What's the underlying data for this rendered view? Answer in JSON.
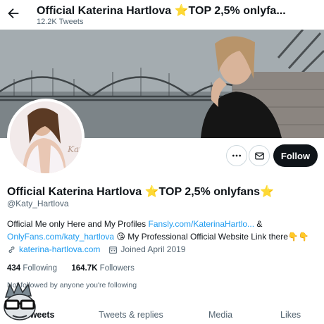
{
  "header": {
    "title": "Official Katerina Hartlova ⭐TOP 2,5% onlyfa...",
    "tweets_count": "12.2K Tweets"
  },
  "profile": {
    "name": "Official Katerina Hartlova ⭐TOP 2,5% onlyfans⭐",
    "handle": "@Katy_Hartlova",
    "bio": {
      "part1": "Official Me only Here and My Profiles ",
      "link1": "Fansly.com/KaterinaHartlo...",
      "part2": " & ",
      "link2": "OnlyFans.com/katy_hartlova",
      "part3": " 😘 My Professional Official Website Link there👇👇"
    },
    "website": "katerina-hartlova.com",
    "joined": "Joined April 2019",
    "following_count": "434",
    "following_label": "Following",
    "followers_count": "164.7K",
    "followers_label": "Followers",
    "followed_by": "Not followed by anyone you're following"
  },
  "actions": {
    "follow_label": "Follow"
  },
  "tabs": [
    {
      "label": "Tweets"
    },
    {
      "label": "Tweets & replies"
    },
    {
      "label": "Media"
    },
    {
      "label": "Likes"
    }
  ],
  "colors": {
    "link": "#1d9bf0",
    "follow_bg": "#0f1419",
    "secondary_text": "#536471"
  }
}
